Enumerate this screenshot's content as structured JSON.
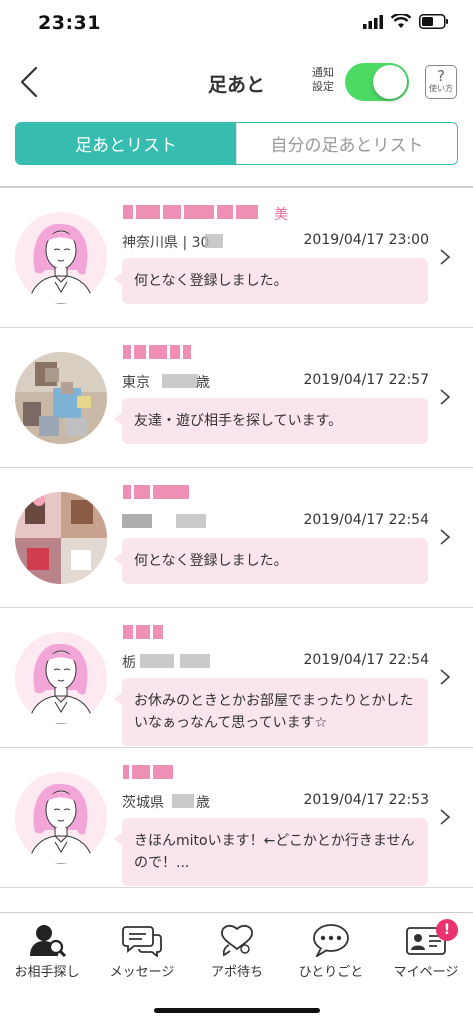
{
  "status_bar": {
    "time": "23:31"
  },
  "nav": {
    "title": "足あと",
    "notify_label_1": "通知",
    "notify_label_2": "設定",
    "help_mark": "?",
    "help_text": "使い方"
  },
  "segments": {
    "active": "足あとリスト",
    "inactive": "自分の足あとリスト"
  },
  "visitors": [
    {
      "name_visible": "美",
      "location": "神奈川県 | 30",
      "timestamp": "2019/04/17 23:00",
      "message": "何となく登録しました。",
      "avatar": "illustration"
    },
    {
      "name_visible": "",
      "location": "東京",
      "location_suffix": "歳",
      "timestamp": "2019/04/17 22:57",
      "message": "友達・遊び相手を探しています。",
      "avatar": "photo"
    },
    {
      "name_visible": "",
      "location": "",
      "timestamp": "2019/04/17 22:54",
      "message": "何となく登録しました。",
      "avatar": "photo-collage"
    },
    {
      "name_visible": "",
      "location": "栃",
      "timestamp": "2019/04/17 22:54",
      "message": "お休みのときとかお部屋でまったりとかしたいなぁっなんて思っています☆",
      "avatar": "illustration"
    },
    {
      "name_visible": "",
      "location": "茨城県",
      "location_suffix": "歳",
      "timestamp": "2019/04/17 22:53",
      "message": "きほんmitoいます！←どこかとか行きませんので！...",
      "avatar": "illustration"
    }
  ],
  "tabbar": {
    "items": [
      {
        "label": "お相手探し",
        "icon": "person-search-icon"
      },
      {
        "label": "メッセージ",
        "icon": "chat-bubbles-icon"
      },
      {
        "label": "アポ待ち",
        "icon": "heart-chat-icon"
      },
      {
        "label": "ひとりごと",
        "icon": "speech-dots-icon"
      },
      {
        "label": "マイページ",
        "icon": "id-card-icon"
      }
    ],
    "badge": "!"
  },
  "colors": {
    "accent": "#37bcb0",
    "toggle_on": "#4cd964",
    "bubble": "#fae4ed",
    "badge": "#e8336e"
  }
}
